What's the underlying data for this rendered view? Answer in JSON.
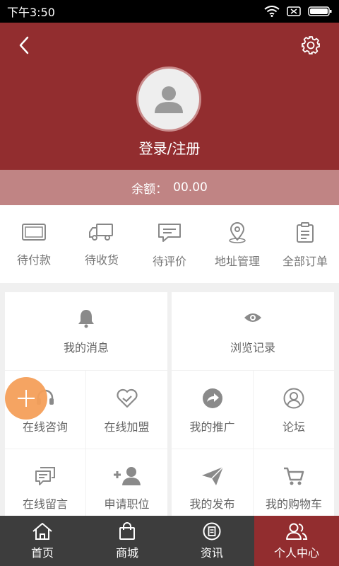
{
  "status": {
    "time": "下午3:50"
  },
  "header": {
    "login_label": "登录/注册"
  },
  "balance": {
    "label": "余额：",
    "value": "00.00"
  },
  "orders": [
    {
      "label": "待付款",
      "icon": "wallet-icon"
    },
    {
      "label": "待收货",
      "icon": "truck-icon"
    },
    {
      "label": "待评价",
      "icon": "comment-icon"
    },
    {
      "label": "地址管理",
      "icon": "location-icon"
    },
    {
      "label": "全部订单",
      "icon": "clipboard-icon"
    }
  ],
  "features": [
    {
      "label": "我的消息",
      "icon": "bell-icon"
    },
    {
      "label": "浏览记录",
      "icon": "eye-icon"
    },
    {
      "label": "在线咨询",
      "icon": "headset-icon"
    },
    {
      "label": "在线加盟",
      "icon": "handshake-icon"
    },
    {
      "label": "我的推广",
      "icon": "share-icon"
    },
    {
      "label": "论坛",
      "icon": "user-circle-icon"
    },
    {
      "label": "在线留言",
      "icon": "message-icon"
    },
    {
      "label": "申请职位",
      "icon": "add-user-icon"
    },
    {
      "label": "我的发布",
      "icon": "paper-plane-icon"
    },
    {
      "label": "我的购物车",
      "icon": "cart-icon"
    }
  ],
  "tabs": [
    {
      "label": "首页",
      "icon": "home-icon"
    },
    {
      "label": "商城",
      "icon": "shopping-bag-icon"
    },
    {
      "label": "资讯",
      "icon": "news-icon"
    },
    {
      "label": "个人中心",
      "icon": "person-center-icon",
      "active": true
    }
  ],
  "colors": {
    "brand": "#922d2f",
    "balance_bar": "#c08484",
    "fab": "#f5a05a",
    "tabbar": "#3d3d3d"
  }
}
